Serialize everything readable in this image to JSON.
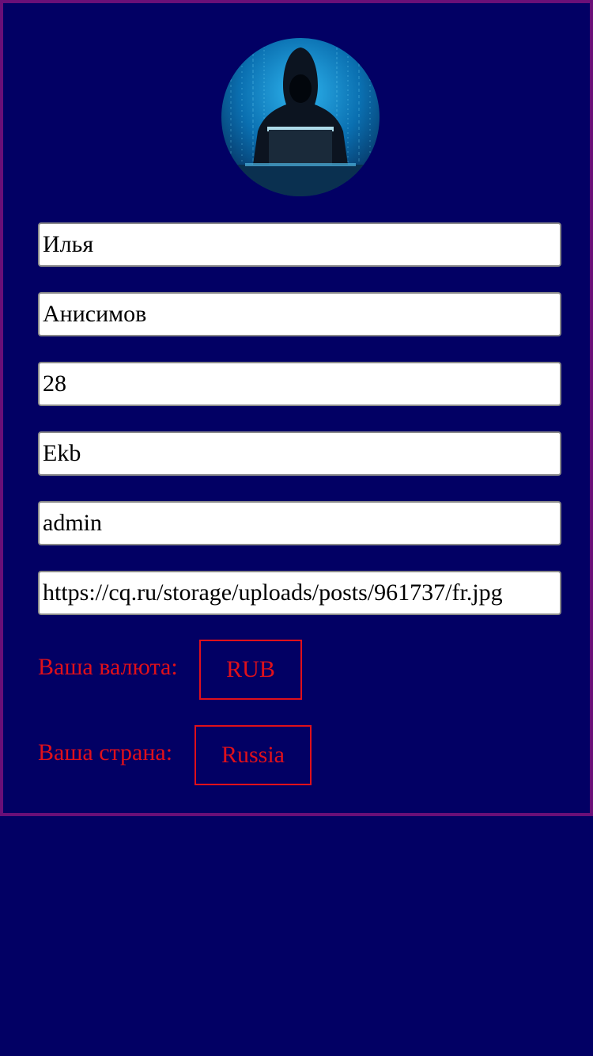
{
  "profile": {
    "avatar_alt": "hacker-avatar",
    "fields": {
      "first_name": "Илья",
      "last_name": "Анисимов",
      "age": "28",
      "city": "Ekb",
      "role": "admin",
      "avatar_url": "https://cq.ru/storage/uploads/posts/961737/fr.jpg"
    }
  },
  "settings": {
    "currency_label": "Ваша валюта:",
    "currency_value": "RUB",
    "country_label": "Ваша страна:",
    "country_value": "Russia"
  },
  "colors": {
    "background": "#020064",
    "card_border": "#6a0f78",
    "accent_red": "#e0101a",
    "input_bg": "#ffffff"
  }
}
